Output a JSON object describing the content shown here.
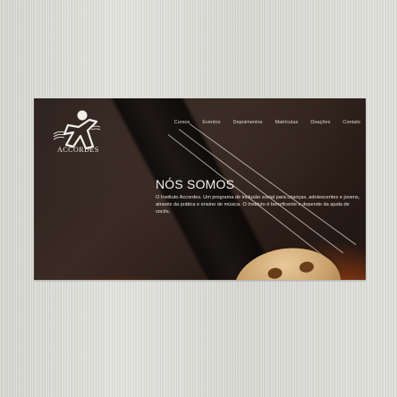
{
  "brand": {
    "name": "ACCORDES"
  },
  "nav": {
    "items": [
      "Cursos",
      "Eventos",
      "Depoimentos",
      "Matrículas",
      "Doações",
      "Contato"
    ]
  },
  "hero": {
    "title": "NÓS SOMOS",
    "text": "O Instituto Accordes. Um programa de inclusão social para crianças, adolescentes e jovens, através da prática e ensino de música. O Instituto é beneficente e depende da ajuda de vocês."
  },
  "colors": {
    "page_bg": "#dcdcd7",
    "hero_text": "#f4f1ec",
    "nav_text": "#ddd6cc"
  }
}
